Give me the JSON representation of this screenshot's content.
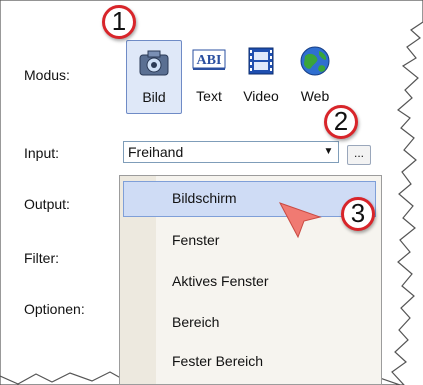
{
  "labels": {
    "modus": "Modus:",
    "input": "Input:",
    "output": "Output:",
    "filter": "Filter:",
    "optionen": "Optionen:"
  },
  "modes": [
    {
      "label": "Bild",
      "icon": "camera-icon",
      "selected": true
    },
    {
      "label": "Text",
      "icon": "text-icon"
    },
    {
      "label": "Video",
      "icon": "film-icon"
    },
    {
      "label": "Web",
      "icon": "globe-icon"
    }
  ],
  "input": {
    "value": "Freihand"
  },
  "browse_label": "...",
  "dropdown": {
    "items": [
      {
        "label": "Bildschirm",
        "selected": true
      },
      {
        "label": "Fenster"
      },
      {
        "label": "Aktives Fenster"
      },
      {
        "label": "Bereich"
      },
      {
        "label": "Fester Bereich"
      }
    ]
  },
  "callouts": [
    "1",
    "2",
    "3"
  ],
  "colors": {
    "callout_border": "#d8252a",
    "highlight": "#cfdcf5",
    "arrow": "#f07a72"
  }
}
